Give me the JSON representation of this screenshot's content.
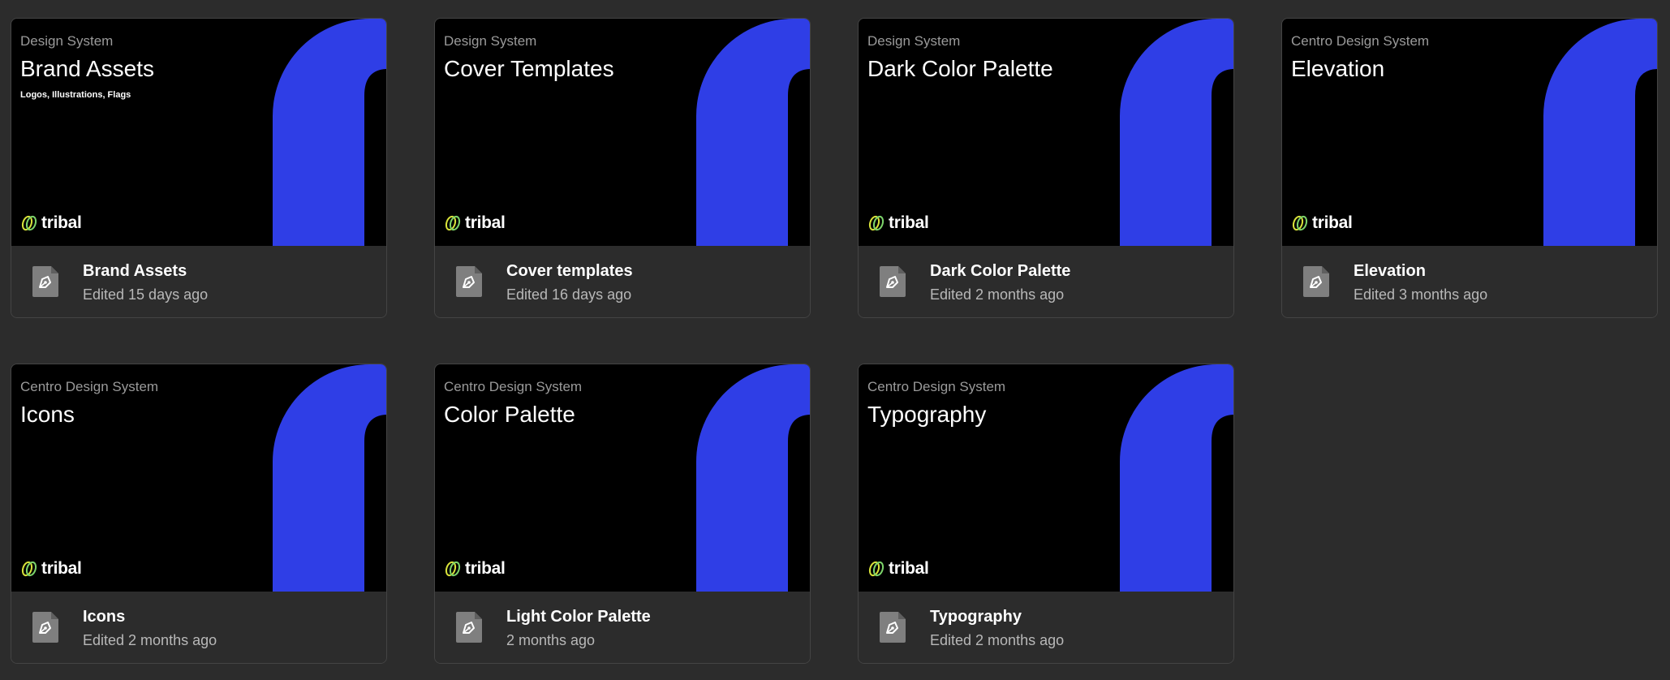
{
  "brand": {
    "logo_text": "tribal",
    "accent_color": "#2f3ee6"
  },
  "cards": [
    {
      "project": "Design System",
      "title": "Brand Assets",
      "subtitle": "Logos, Illustrations, Flags",
      "file_name": "Brand Assets",
      "edited": "Edited 15 days ago",
      "icon": "pen-tool-file-icon"
    },
    {
      "project": "Design System",
      "title": "Cover Templates",
      "subtitle": "",
      "file_name": "Cover templates",
      "edited": "Edited 16 days ago",
      "icon": "pen-tool-file-icon"
    },
    {
      "project": "Design System",
      "title": "Dark Color Palette",
      "subtitle": "",
      "file_name": "Dark Color Palette",
      "edited": "Edited 2 months ago",
      "icon": "pen-tool-file-icon"
    },
    {
      "project": "Centro Design System",
      "title": "Elevation",
      "subtitle": "",
      "file_name": "Elevation",
      "edited": "Edited 3 months ago",
      "icon": "pen-tool-file-icon"
    },
    {
      "project": "Centro Design System",
      "title": "Icons",
      "subtitle": "",
      "file_name": "Icons",
      "edited": "Edited 2 months ago",
      "icon": "pen-tool-file-icon"
    },
    {
      "project": "Centro Design System",
      "title": "Color Palette",
      "subtitle": "",
      "file_name": "Light Color Palette",
      "edited": "2 months ago",
      "icon": "pen-tool-file-icon"
    },
    {
      "project": "Centro Design System",
      "title": "Typography",
      "subtitle": "",
      "file_name": "Typography",
      "edited": "Edited 2 months ago",
      "icon": "pen-tool-file-icon"
    }
  ]
}
